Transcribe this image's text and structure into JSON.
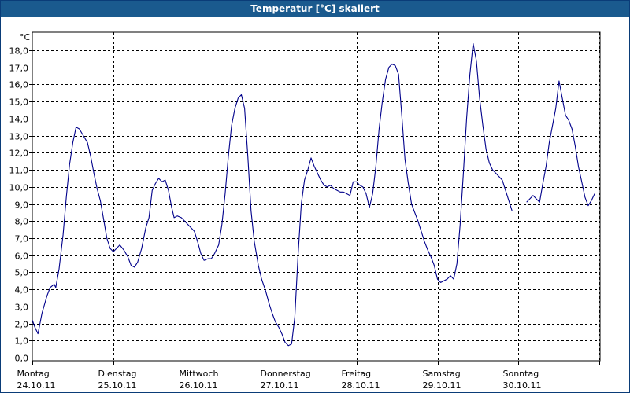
{
  "window": {
    "title": "Temperatur [°C] skaliert"
  },
  "chart_data": {
    "type": "line",
    "title": "Temperatur [°C] skaliert",
    "unit": "°C",
    "ylim": [
      0,
      19.0
    ],
    "y_ticks": [
      "0,0",
      "1,0",
      "2,0",
      "3,0",
      "4,0",
      "5,0",
      "6,0",
      "7,0",
      "8,0",
      "9,0",
      "10,0",
      "11,0",
      "12,0",
      "13,0",
      "14,0",
      "15,0",
      "16,0",
      "17,0",
      "18,0"
    ],
    "x_categories": [
      {
        "day": "Montag",
        "date": "24.10.11"
      },
      {
        "day": "Dienstag",
        "date": "25.10.11"
      },
      {
        "day": "Mittwoch",
        "date": "26.10.11"
      },
      {
        "day": "Donnerstag",
        "date": "27.10.11"
      },
      {
        "day": "Freitag",
        "date": "28.10.11"
      },
      {
        "day": "Samstag",
        "date": "29.10.11"
      },
      {
        "day": "Sonntag",
        "date": "30.10.11"
      }
    ],
    "grid": true,
    "series": [
      {
        "color": "#00008b",
        "segments": [
          [
            [
              0.0,
              2.2
            ],
            [
              0.03,
              1.8
            ],
            [
              0.07,
              1.4
            ],
            [
              0.12,
              2.6
            ],
            [
              0.18,
              3.6
            ],
            [
              0.22,
              4.1
            ],
            [
              0.27,
              4.3
            ],
            [
              0.29,
              4.1
            ],
            [
              0.33,
              5.2
            ],
            [
              0.38,
              7.2
            ],
            [
              0.42,
              9.4
            ],
            [
              0.46,
              11.3
            ],
            [
              0.5,
              12.6
            ],
            [
              0.54,
              13.5
            ],
            [
              0.58,
              13.4
            ],
            [
              0.63,
              13.0
            ],
            [
              0.68,
              12.6
            ],
            [
              0.72,
              11.8
            ],
            [
              0.76,
              10.8
            ],
            [
              0.8,
              9.9
            ],
            [
              0.84,
              9.2
            ],
            [
              0.88,
              8.1
            ],
            [
              0.92,
              7.0
            ],
            [
              0.96,
              6.4
            ],
            [
              1.0,
              6.2
            ],
            [
              1.04,
              6.4
            ],
            [
              1.08,
              6.6
            ],
            [
              1.13,
              6.3
            ],
            [
              1.18,
              5.9
            ],
            [
              1.22,
              5.4
            ],
            [
              1.26,
              5.3
            ],
            [
              1.3,
              5.6
            ],
            [
              1.35,
              6.4
            ],
            [
              1.4,
              7.6
            ],
            [
              1.44,
              8.2
            ],
            [
              1.48,
              9.8
            ],
            [
              1.52,
              10.2
            ],
            [
              1.56,
              10.5
            ],
            [
              1.6,
              10.3
            ],
            [
              1.64,
              10.4
            ],
            [
              1.68,
              9.8
            ],
            [
              1.72,
              8.8
            ],
            [
              1.75,
              8.2
            ],
            [
              1.79,
              8.3
            ],
            [
              1.84,
              8.2
            ],
            [
              1.88,
              8.0
            ],
            [
              1.92,
              7.8
            ],
            [
              1.96,
              7.6
            ],
            [
              2.0,
              7.4
            ],
            [
              2.04,
              6.8
            ],
            [
              2.08,
              6.1
            ],
            [
              2.12,
              5.7
            ],
            [
              2.17,
              5.8
            ],
            [
              2.21,
              5.8
            ],
            [
              2.25,
              6.1
            ],
            [
              2.3,
              6.6
            ],
            [
              2.34,
              7.8
            ],
            [
              2.38,
              9.6
            ],
            [
              2.42,
              11.8
            ],
            [
              2.46,
              13.6
            ],
            [
              2.5,
              14.6
            ],
            [
              2.54,
              15.2
            ],
            [
              2.58,
              15.4
            ],
            [
              2.62,
              14.6
            ],
            [
              2.66,
              11.8
            ],
            [
              2.7,
              8.6
            ],
            [
              2.74,
              6.8
            ],
            [
              2.79,
              5.4
            ],
            [
              2.83,
              4.6
            ],
            [
              2.88,
              3.9
            ],
            [
              2.92,
              3.2
            ],
            [
              2.96,
              2.6
            ],
            [
              3.0,
              2.1
            ],
            [
              3.04,
              1.8
            ],
            [
              3.08,
              1.4
            ],
            [
              3.12,
              0.9
            ],
            [
              3.16,
              0.7
            ],
            [
              3.2,
              0.8
            ],
            [
              3.24,
              2.4
            ],
            [
              3.28,
              6.0
            ],
            [
              3.32,
              9.0
            ],
            [
              3.36,
              10.4
            ],
            [
              3.4,
              11.0
            ],
            [
              3.44,
              11.7
            ],
            [
              3.48,
              11.2
            ],
            [
              3.52,
              10.8
            ],
            [
              3.56,
              10.4
            ],
            [
              3.6,
              10.1
            ],
            [
              3.64,
              10.0
            ],
            [
              3.68,
              10.1
            ],
            [
              3.72,
              9.9
            ],
            [
              3.76,
              9.8
            ],
            [
              3.8,
              9.7
            ],
            [
              3.84,
              9.7
            ],
            [
              3.88,
              9.6
            ],
            [
              3.92,
              9.5
            ],
            [
              3.96,
              10.3
            ],
            [
              4.0,
              10.3
            ],
            [
              4.04,
              10.1
            ],
            [
              4.08,
              10.0
            ],
            [
              4.12,
              9.6
            ],
            [
              4.16,
              8.8
            ],
            [
              4.2,
              9.6
            ],
            [
              4.24,
              11.2
            ],
            [
              4.28,
              13.4
            ],
            [
              4.32,
              15.0
            ],
            [
              4.36,
              16.3
            ],
            [
              4.4,
              17.0
            ],
            [
              4.44,
              17.2
            ],
            [
              4.48,
              17.1
            ],
            [
              4.52,
              16.6
            ],
            [
              4.56,
              14.2
            ],
            [
              4.6,
              11.6
            ],
            [
              4.64,
              10.2
            ],
            [
              4.68,
              9.0
            ],
            [
              4.72,
              8.5
            ],
            [
              4.76,
              8.0
            ],
            [
              4.8,
              7.4
            ],
            [
              4.84,
              6.8
            ],
            [
              4.88,
              6.3
            ],
            [
              4.92,
              5.9
            ],
            [
              4.96,
              5.4
            ],
            [
              5.0,
              4.6
            ],
            [
              5.04,
              4.4
            ],
            [
              5.08,
              4.5
            ],
            [
              5.12,
              4.6
            ],
            [
              5.16,
              4.8
            ],
            [
              5.2,
              4.6
            ],
            [
              5.24,
              5.5
            ],
            [
              5.28,
              7.8
            ],
            [
              5.32,
              10.8
            ],
            [
              5.36,
              14.0
            ],
            [
              5.4,
              16.6
            ],
            [
              5.44,
              18.4
            ],
            [
              5.48,
              17.4
            ],
            [
              5.52,
              15.2
            ],
            [
              5.56,
              13.6
            ],
            [
              5.6,
              12.2
            ],
            [
              5.64,
              11.4
            ],
            [
              5.68,
              11.0
            ],
            [
              5.72,
              10.8
            ],
            [
              5.76,
              10.6
            ],
            [
              5.8,
              10.4
            ],
            [
              5.84,
              9.8
            ],
            [
              5.88,
              9.2
            ],
            [
              5.92,
              8.6
            ]
          ],
          [
            [
              6.1,
              9.1
            ],
            [
              6.14,
              9.3
            ],
            [
              6.18,
              9.5
            ],
            [
              6.22,
              9.3
            ],
            [
              6.26,
              9.1
            ],
            [
              6.3,
              10.2
            ],
            [
              6.34,
              11.2
            ],
            [
              6.38,
              12.6
            ],
            [
              6.42,
              13.6
            ],
            [
              6.46,
              14.6
            ],
            [
              6.5,
              16.2
            ],
            [
              6.54,
              15.2
            ],
            [
              6.58,
              14.2
            ],
            [
              6.62,
              13.9
            ],
            [
              6.66,
              13.4
            ],
            [
              6.7,
              12.4
            ],
            [
              6.74,
              11.2
            ],
            [
              6.78,
              10.3
            ],
            [
              6.82,
              9.4
            ],
            [
              6.86,
              8.9
            ],
            [
              6.9,
              9.2
            ],
            [
              6.94,
              9.6
            ]
          ]
        ]
      }
    ]
  }
}
